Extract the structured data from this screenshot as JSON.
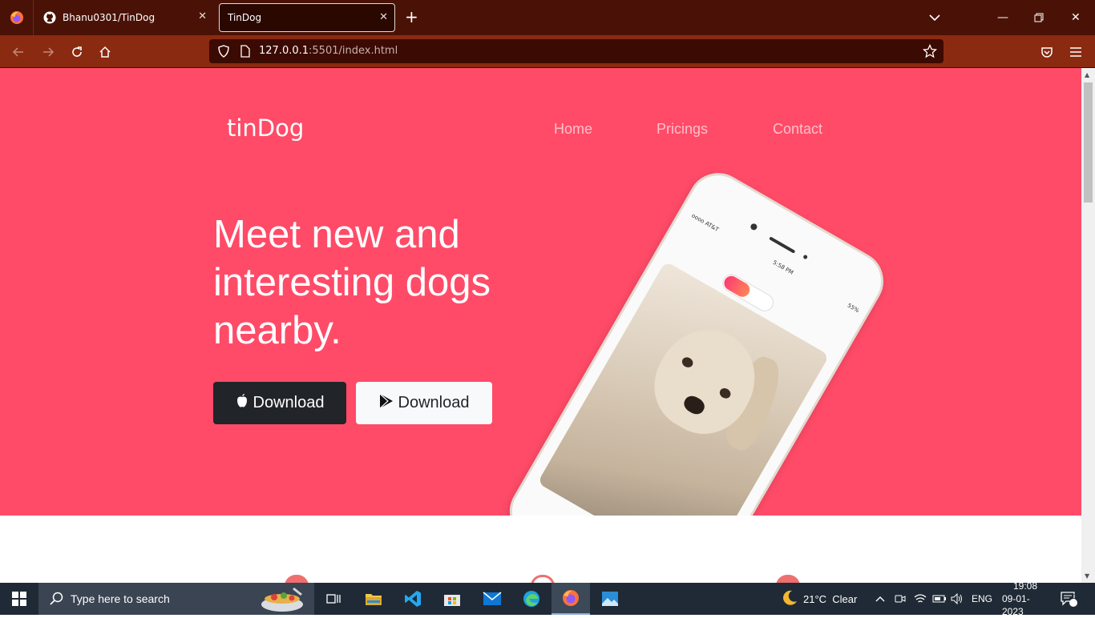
{
  "browser": {
    "tabs": [
      {
        "title": "Bhanu0301/TinDog",
        "icon": "github-icon"
      },
      {
        "title": "TinDog",
        "icon": "none",
        "active": true
      }
    ],
    "url": {
      "host": "127.0.0.1",
      "rest": ":5501/index.html"
    }
  },
  "page": {
    "brand": "tinDog",
    "nav": [
      "Home",
      "Pricings",
      "Contact"
    ],
    "headline": "Meet new and interesting dogs nearby.",
    "buttons": {
      "ios": "Download",
      "android": "Download"
    },
    "phone": {
      "carrier": "oooo AT&T",
      "time": "5:58 PM",
      "battery": "55%"
    },
    "colors": {
      "hero": "#ff4b68",
      "dark_button": "#212529"
    }
  },
  "taskbar": {
    "search_placeholder": "Type here to search",
    "weather": "21°C  Clear",
    "lang": "ENG",
    "time": "19:08",
    "date": "09-01-2023",
    "notifications": "1"
  }
}
